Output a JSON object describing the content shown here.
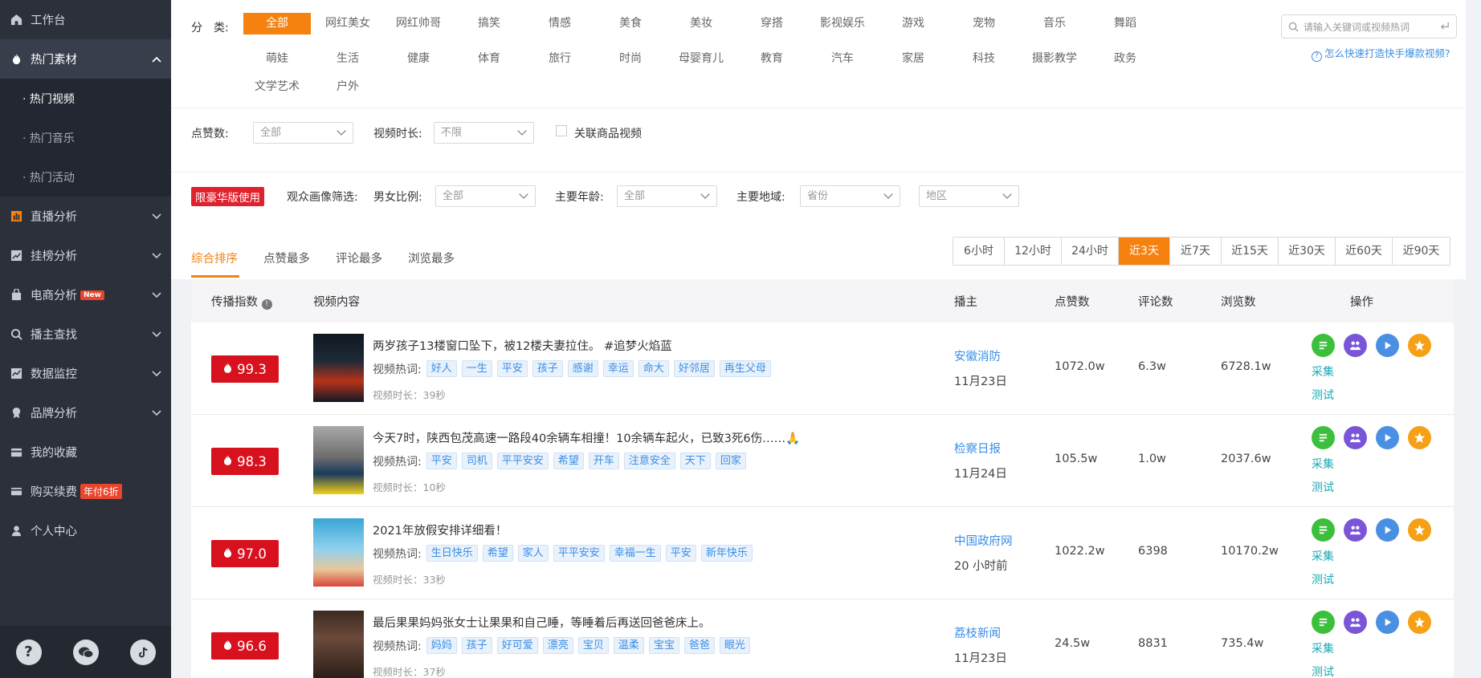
{
  "sidebar": {
    "items": [
      {
        "label": "工作台",
        "icon": "home-icon"
      },
      {
        "label": "热门素材",
        "icon": "flame-icon"
      },
      {
        "label": "直播分析",
        "icon": "bar-chart-icon"
      },
      {
        "label": "挂榜分析",
        "icon": "trend-chart-icon"
      },
      {
        "label": "电商分析",
        "icon": "shopping-bag-icon",
        "badge": "New"
      },
      {
        "label": "播主查找",
        "icon": "search-icon"
      },
      {
        "label": "数据监控",
        "icon": "monitor-chart-icon"
      },
      {
        "label": "品牌分析",
        "icon": "brand-badge-icon"
      },
      {
        "label": "我的收藏",
        "icon": "wallet-icon"
      },
      {
        "label": "购买续费",
        "icon": "card-icon",
        "badge": "年付6折"
      },
      {
        "label": "个人中心",
        "icon": "user-icon"
      }
    ],
    "sub_items": [
      "· 热门视频",
      "· 热门音乐",
      "· 热门活动"
    ]
  },
  "filters": {
    "category_label": "分　类:",
    "categories_row1": [
      "全部",
      "网红美女",
      "网红帅哥",
      "搞笑",
      "情感",
      "美食",
      "美妆",
      "穿搭",
      "影视娱乐",
      "游戏",
      "宠物",
      "音乐",
      "舞蹈"
    ],
    "categories_row2": [
      "萌娃",
      "生活",
      "健康",
      "体育",
      "旅行",
      "时尚",
      "母婴育儿",
      "教育",
      "汽车",
      "家居",
      "科技",
      "摄影教学",
      "政务"
    ],
    "categories_row3": [
      "文学艺术",
      "户外"
    ],
    "likes_label": "点赞数:",
    "likes_value": "全部",
    "duration_label": "视频时长:",
    "duration_value": "不限",
    "related_goods_label": "关联商品视频",
    "vip_tag": "限豪华版使用",
    "audience_label": "观众画像筛选:",
    "gender_label": "男女比例:",
    "gender_value": "全部",
    "age_label": "主要年龄:",
    "age_value": "全部",
    "region_label": "主要地域:",
    "province_value": "省份",
    "area_value": "地区",
    "search_placeholder": "请输入关键词或视频热词",
    "help_link": "怎么快速打造快手爆款视频?"
  },
  "sort_tabs": [
    "综合排序",
    "点赞最多",
    "评论最多",
    "浏览最多"
  ],
  "time_ranges": [
    "6小时",
    "12小时",
    "24小时",
    "近3天",
    "近7天",
    "近15天",
    "近30天",
    "近60天",
    "近90天"
  ],
  "table": {
    "headers": {
      "index": "传播指数",
      "content": "视频内容",
      "anchor": "播主",
      "likes": "点赞数",
      "comments": "评论数",
      "views": "浏览数",
      "ops": "操作"
    },
    "hot_label": "视频热词:",
    "op_collect": "采集",
    "op_test": "测试",
    "rows": [
      {
        "score": "99.3",
        "title": "两岁孩子13楼窗口坠下，被12楼夫妻拉住。 #追梦火焰蓝",
        "tags": [
          "好人",
          "一生",
          "平安",
          "孩子",
          "感谢",
          "幸运",
          "命大",
          "好邻居",
          "再生父母"
        ],
        "duration": "视频时长：39秒",
        "anchor": "安徽消防",
        "date": "11月23日",
        "likes": "1072.0w",
        "comments": "6.3w",
        "views": "6728.1w"
      },
      {
        "score": "98.3",
        "title": "今天7时，陕西包茂高速一路段40余辆车相撞！10余辆车起火，已致3死6伤……🙏",
        "tags": [
          "平安",
          "司机",
          "平平安安",
          "希望",
          "开车",
          "注意安全",
          "天下",
          "回家"
        ],
        "duration": "视频时长：10秒",
        "anchor": "检察日报",
        "date": "11月24日",
        "likes": "105.5w",
        "comments": "1.0w",
        "views": "2037.6w"
      },
      {
        "score": "97.0",
        "title": "2021年放假安排详细看！",
        "tags": [
          "生日快乐",
          "希望",
          "家人",
          "平平安安",
          "幸福一生",
          "平安",
          "新年快乐"
        ],
        "duration": "视频时长：33秒",
        "anchor": "中国政府网",
        "date": "20 小时前",
        "likes": "1022.2w",
        "comments": "6398",
        "views": "10170.2w"
      },
      {
        "score": "96.6",
        "title": "最后果果妈妈张女士让果果和自己睡，等睡着后再送回爸爸床上。",
        "tags": [
          "妈妈",
          "孩子",
          "好可爱",
          "漂亮",
          "宝贝",
          "温柔",
          "宝宝",
          "爸爸",
          "眼光"
        ],
        "duration": "视频时长：37秒",
        "anchor": "荔枝新闻",
        "date": "11月23日",
        "likes": "24.5w",
        "comments": "8831",
        "views": "735.4w"
      }
    ]
  }
}
